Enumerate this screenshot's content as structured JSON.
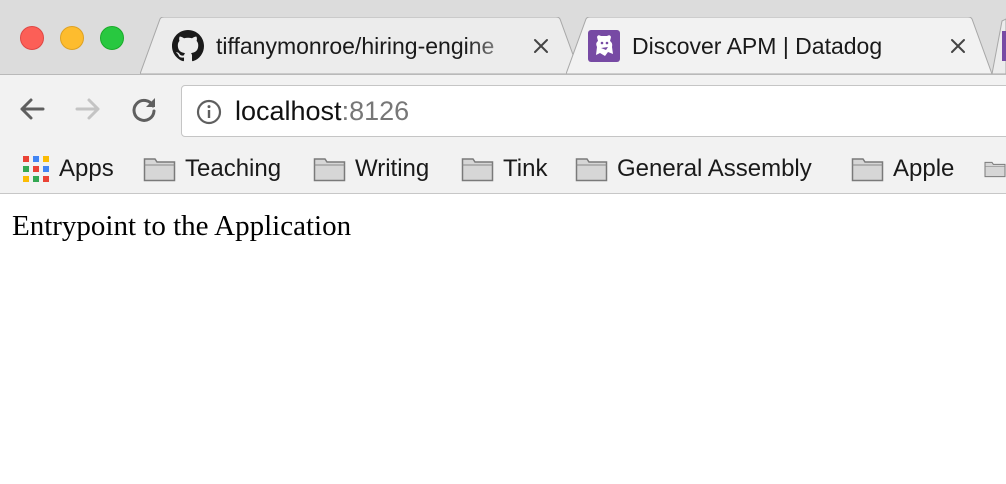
{
  "browser": {
    "tabs": [
      {
        "title": "tiffanymonroe/hiring-engine",
        "icon": "github-icon",
        "active": false
      },
      {
        "title": "Discover APM | Datadog",
        "icon": "datadog-icon",
        "active": true
      }
    ],
    "address": {
      "host": "localhost",
      "port": ":8126"
    },
    "bookmarks": [
      {
        "label": "Apps",
        "icon": "apps-grid-icon"
      },
      {
        "label": "Teaching",
        "icon": "folder-icon"
      },
      {
        "label": "Writing",
        "icon": "folder-icon"
      },
      {
        "label": "Tink",
        "icon": "folder-icon"
      },
      {
        "label": "General Assembly",
        "icon": "folder-icon"
      },
      {
        "label": "Apple",
        "icon": "folder-icon"
      },
      {
        "label": "",
        "icon": "folder-icon"
      }
    ],
    "colors": {
      "tabstrip": "#dcdcdc",
      "toolbar": "#f2f2f2",
      "close": "#fc5f57",
      "minimize": "#fdbc2e",
      "maximize": "#28c840",
      "datadog": "#774aa4"
    }
  },
  "page": {
    "heading": "Entrypoint to the Application"
  }
}
